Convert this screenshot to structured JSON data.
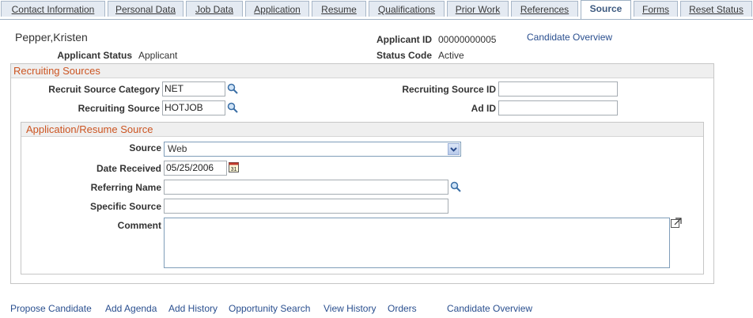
{
  "tabs": [
    {
      "label": "Contact Information"
    },
    {
      "label": "Personal Data"
    },
    {
      "label": "Job Data"
    },
    {
      "label": "Application"
    },
    {
      "label": "Resume"
    },
    {
      "label": "Qualifications"
    },
    {
      "label": "Prior Work"
    },
    {
      "label": "References"
    },
    {
      "label": "Source"
    },
    {
      "label": "Forms"
    },
    {
      "label": "Reset Status"
    }
  ],
  "header": {
    "name": "Pepper,Kristen",
    "applicant_id_label": "Applicant ID",
    "applicant_id": "00000000005",
    "candidate_overview": "Candidate Overview",
    "status_label": "Applicant Status",
    "status_value": "Applicant",
    "status_code_label": "Status Code",
    "status_code_value": "Active"
  },
  "recruiting_sources": {
    "title": "Recruiting Sources",
    "category_label": "Recruit Source Category",
    "category_value": "NET",
    "source_label": "Recruiting Source",
    "source_value": "HOTJOB",
    "source_id_label": "Recruiting Source ID",
    "source_id_value": "",
    "ad_id_label": "Ad ID",
    "ad_id_value": ""
  },
  "application_source": {
    "title": "Application/Resume Source",
    "source_label": "Source",
    "source_value": "Web",
    "date_label": "Date Received",
    "date_value": "05/25/2006",
    "referring_label": "Referring Name",
    "referring_value": "",
    "specific_label": "Specific Source",
    "specific_value": "",
    "comment_label": "Comment",
    "comment_value": ""
  },
  "footer_links": [
    {
      "label": "Propose Candidate"
    },
    {
      "label": "Add Agenda"
    },
    {
      "label": "Add History"
    },
    {
      "label": "Opportunity Search"
    },
    {
      "label": "View History"
    },
    {
      "label": "Orders"
    },
    {
      "label": "Candidate Overview"
    }
  ],
  "colors": {
    "tab_bg": "#e4eaf2",
    "active_tab_text": "#3d5a80",
    "group_title": "#cc5522",
    "link": "#2a4f8f"
  },
  "icons": {
    "lookup": "magnifier-icon",
    "calendar": "calendar-icon",
    "expand": "expand-window-icon",
    "dropdown": "chevron-down-icon"
  }
}
